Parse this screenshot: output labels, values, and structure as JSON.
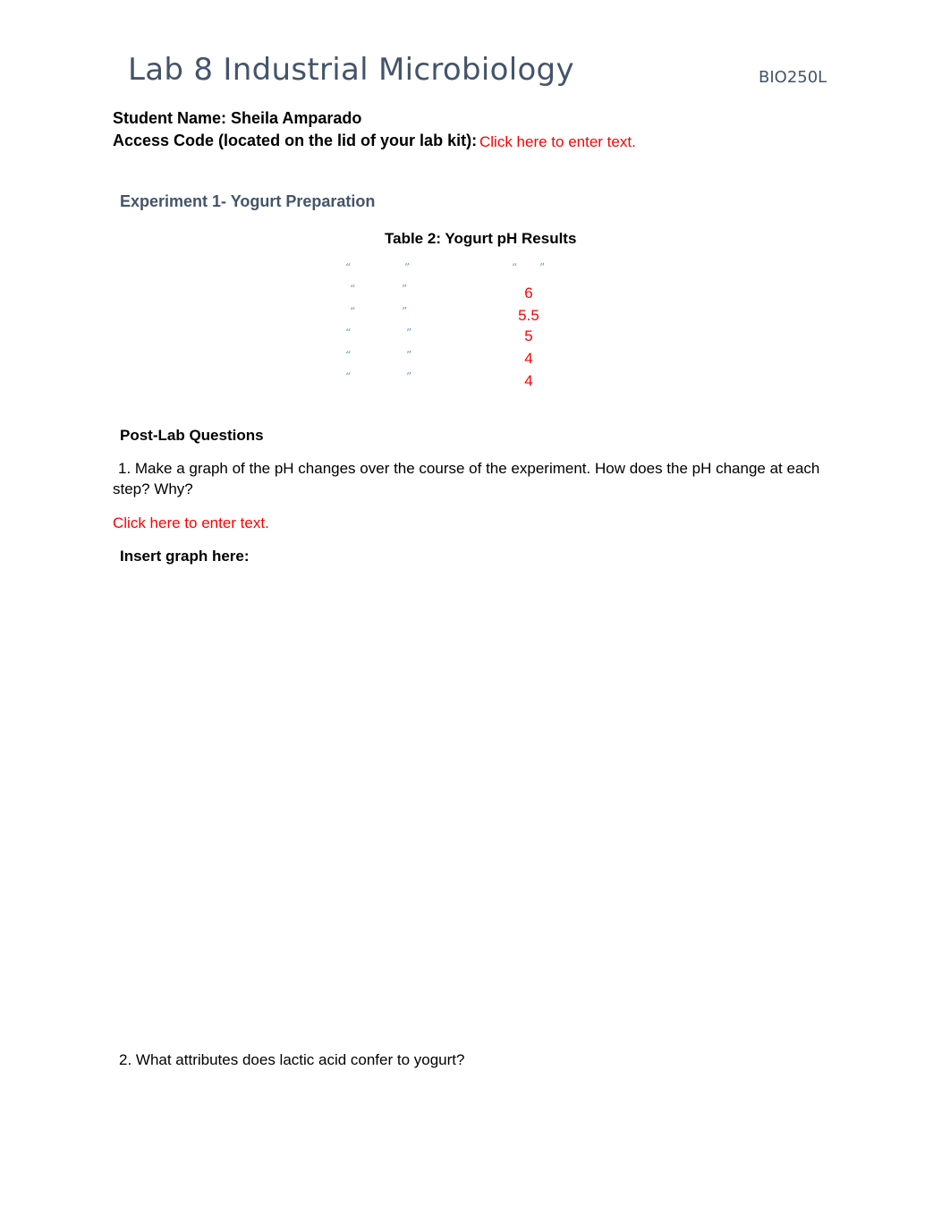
{
  "header": {
    "title": "Lab 8 Industrial Microbiology",
    "course_code": "BIO250L"
  },
  "student": {
    "name_label": "Student Name: Sheila Amparado",
    "access_label": "Access Code (located on the lid of your lab kit):",
    "access_value": "Click here to enter text."
  },
  "experiment": {
    "heading": "Experiment 1- Yogurt Preparation",
    "table": {
      "title": "Table 2: Yogurt pH Results",
      "header": {
        "col1": {
          "open": "“",
          "close": "”"
        },
        "col2": {
          "open": "“",
          "close": "”"
        }
      },
      "rows": [
        {
          "open": "“",
          "close": "”",
          "ph": "6"
        },
        {
          "open": "“",
          "close": "”",
          "ph": "5.5"
        },
        {
          "open": "“",
          "close": "”",
          "ph": "5"
        },
        {
          "open": "“",
          "close": "”",
          "ph": "4"
        },
        {
          "open": "“",
          "close": "”",
          "ph": "4"
        }
      ]
    }
  },
  "post_lab": {
    "heading": "Post-Lab Questions",
    "q1_line1": "1. Make a graph of the pH changes over the course of the experiment.  How does the pH change at each",
    "q1_line2": "step?  Why?",
    "q1_answer": "Click here to enter text.",
    "graph_label": "Insert graph here:",
    "q2": "2. What attributes does lactic acid confer to yogurt?"
  }
}
